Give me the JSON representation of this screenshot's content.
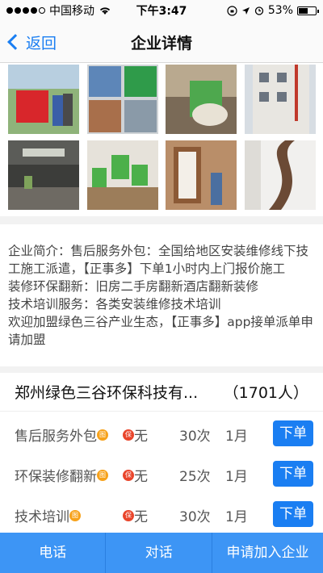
{
  "status_bar": {
    "carrier": "中国移动",
    "time": "下午3:47",
    "battery": "53%",
    "battery_level": 0.53
  },
  "nav": {
    "back_label": "返回",
    "title": "企业详情"
  },
  "intro": {
    "lines": [
      "企业简介：售后服务外包：全国给地区安装维修线下技工施工派遣，【正事多】下单1小时内上门报价施工",
      "装修环保翻新：旧房二手房翻新酒店翻新装修",
      "技术培训服务：各类安装维修技术培训",
      "欢迎加盟绿色三谷产业生态，【正事多】app接单派单申请加盟"
    ]
  },
  "company": {
    "name": "郑州绿色三谷环保科技有...",
    "count": "（1701人）",
    "services": [
      {
        "name": "售后服务外包",
        "tu": "图",
        "bao": "保",
        "flag": "无",
        "count": "30次",
        "period": "1月",
        "button": "下单"
      },
      {
        "name": "环保装修翻新",
        "tu": "图",
        "bao": "保",
        "flag": "无",
        "count": "25次",
        "period": "1月",
        "button": "下单"
      },
      {
        "name": "技术培训",
        "tu": "图",
        "bao": "保",
        "flag": "无",
        "count": "30次",
        "period": "1月",
        "button": "下单"
      }
    ]
  },
  "bottom": {
    "phone": "电话",
    "chat": "对话",
    "join": "申请加入企业"
  },
  "colors": {
    "accent": "#1a7ef2",
    "bottom_bar": "#3d95f5",
    "badge_tu": "#f7a21b",
    "badge_bao": "#e9452b"
  }
}
